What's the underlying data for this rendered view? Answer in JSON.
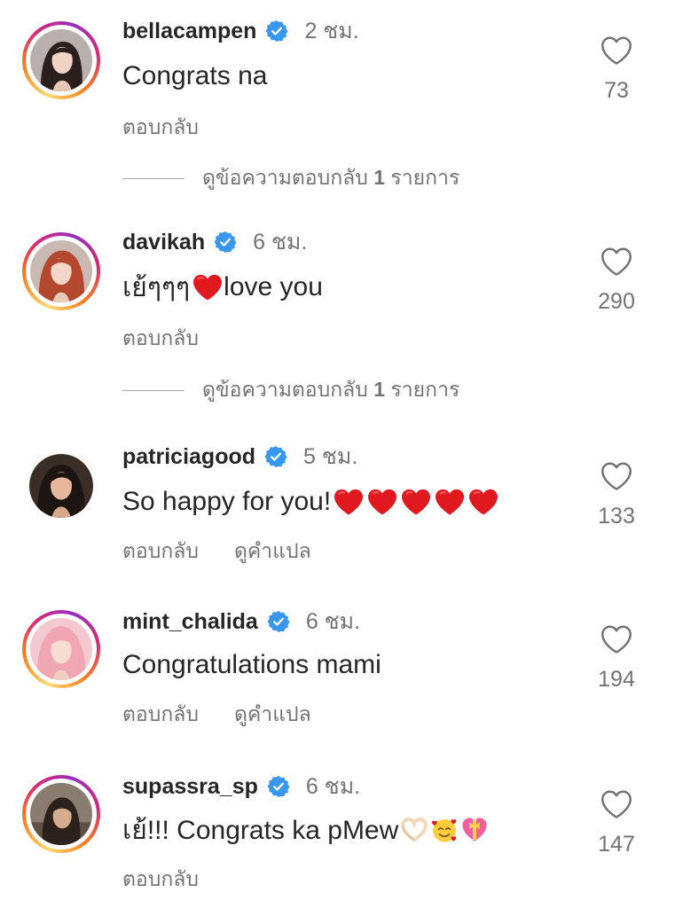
{
  "comments": [
    {
      "username": "bellacampen",
      "time": "2 ชม.",
      "text": "Congrats na",
      "likes": "73",
      "reply_label": "ตอบกลับ",
      "view_replies": {
        "prefix": "ดูข้อความตอบกลับ",
        "count": "1",
        "suffix": "รายการ"
      }
    },
    {
      "username": "davikah",
      "time": "6 ชม.",
      "text": "เย้ๆๆๆ",
      "text_after_emoji": "love you",
      "likes": "290",
      "reply_label": "ตอบกลับ",
      "view_replies": {
        "prefix": "ดูข้อความตอบกลับ",
        "count": "1",
        "suffix": "รายการ"
      }
    },
    {
      "username": "patriciagood",
      "time": "5 ชม.",
      "text": "So happy for you!",
      "likes": "133",
      "reply_label": "ตอบกลับ",
      "translate_label": "ดูคำแปล"
    },
    {
      "username": "mint_chalida",
      "time": "6 ชม.",
      "text": "Congratulations mami",
      "likes": "194",
      "reply_label": "ตอบกลับ",
      "translate_label": "ดูคำแปล"
    },
    {
      "username": "supassra_sp",
      "time": "6 ชม.",
      "text": "เย้!!! Congrats ka pMew",
      "likes": "147",
      "reply_label": "ตอบกลับ"
    }
  ],
  "icons": {
    "verified": "verified-badge-icon",
    "like": "heart-outline-icon",
    "emoji_heart": "red-heart-emoji",
    "emoji_hands": "heart-hands-emoji",
    "emoji_smile": "smiling-face-with-hearts-emoji",
    "emoji_gift": "heart-with-ribbon-emoji"
  },
  "colors": {
    "verified_blue": "#3897f0",
    "text_primary": "#262626",
    "text_secondary": "#737373",
    "emoji_red": "#e0191e"
  }
}
